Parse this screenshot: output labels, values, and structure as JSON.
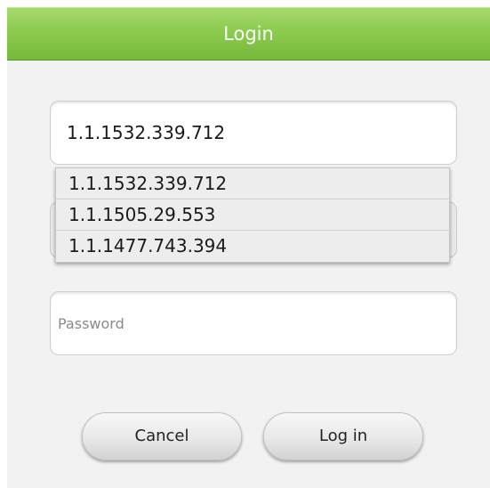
{
  "dialog": {
    "title": "Login"
  },
  "server_field": {
    "value": "1.1.1532.339.712"
  },
  "suggestions": [
    "1.1.1532.339.712",
    "1.1.1505.29.553",
    "1.1.1477.743.394"
  ],
  "password_field": {
    "placeholder": "Password",
    "value": ""
  },
  "buttons": {
    "cancel": "Cancel",
    "login": "Log in"
  },
  "colors": {
    "titlebar": "#8ccb4e",
    "title_text": "#ffffff",
    "body_background": "#f2f2f2"
  }
}
